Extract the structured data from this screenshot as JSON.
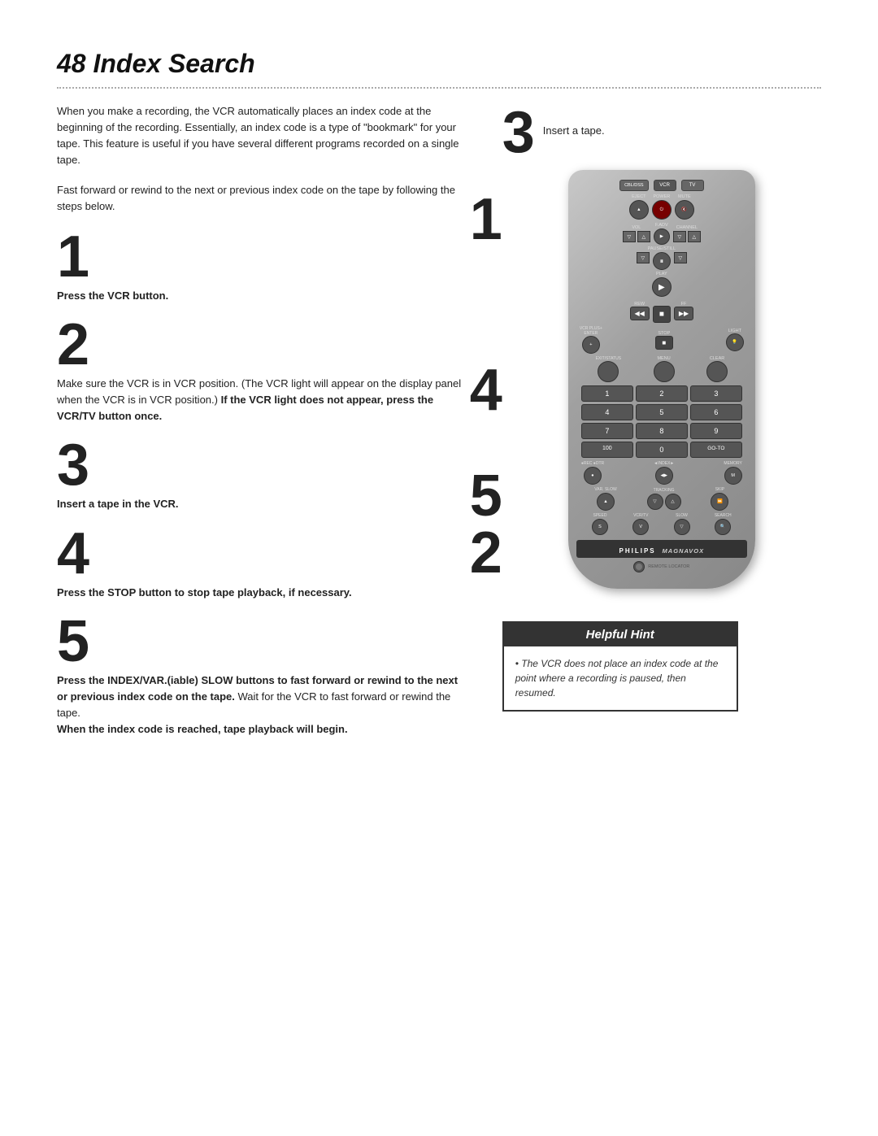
{
  "page": {
    "title": "48  Index Search",
    "dotted_rule": true
  },
  "intro": {
    "para1": "When you make a recording, the VCR automatically places an index code at the beginning of the recording. Essentially, an index code is a type of \"bookmark\" for your tape. This feature is useful if you have several different programs recorded on a single tape.",
    "para2": "Fast forward or rewind to the next or previous index code on the tape by following the steps below."
  },
  "steps": [
    {
      "number": "1",
      "text_normal": "",
      "text_bold": "Press the VCR button."
    },
    {
      "number": "2",
      "text_normal": "Make sure the VCR is in VCR position. (The VCR light will appear on the display panel when the VCR is in VCR position.) ",
      "text_bold": "If the VCR light does not appear, press the VCR/TV button once."
    },
    {
      "number": "3",
      "text_normal": "",
      "text_bold": "Insert a tape in the VCR."
    },
    {
      "number": "4",
      "text_normal": "",
      "text_bold": "Press the STOP button to stop tape playback, if necessary."
    },
    {
      "number": "5",
      "text_normal": "Press the INDEX/VAR.(iable) SLOW buttons to fast forward or rewind to the next or previous index code on the tape. ",
      "text_normal2": "Wait for the VCR to fast forward or rewind the tape.",
      "text_bold": "When the index code is reached, tape playback will begin."
    }
  ],
  "right_steps": [
    {
      "number": "3",
      "label": "Insert a tape."
    }
  ],
  "remote": {
    "buttons": {
      "cbl_dss": "CBL/DSS",
      "vcr": "VCR",
      "tv": "TV",
      "eject": "EJECT",
      "power": "POWER",
      "mute": "MUTE",
      "vol": "VOL",
      "fadv": "F.ADV",
      "channel": "CHANNEL",
      "pause_still": "PAUSE/STILL",
      "play": "PLAY",
      "rew": "REW",
      "ff": "FF",
      "stop": "STOP",
      "vcr_plus": "VCR PLUS+ ENTER",
      "light": "LIGHT",
      "exit_status": "EXIT/STATUS",
      "menu": "MENU",
      "clear": "CLEAR",
      "num1": "1",
      "num2": "2",
      "num3": "3",
      "num4": "4",
      "num5": "5",
      "num6": "6",
      "num7": "7",
      "num8": "8",
      "num9": "9",
      "num100": "100",
      "num0": "0",
      "goto": "GO-TO",
      "index": "◄INDEX►",
      "memory": "MEMORY",
      "var_slow": "VAR. SLOW",
      "tracking": "TRACKING",
      "skip": "SKIP",
      "speed": "SPEED",
      "vcr_tv": "VCR/TV",
      "slow": "SLOW",
      "search": "SEARCH"
    },
    "brand": "PHILIPS MAGNAVOX",
    "remote_locator": "REMOTE LOCATOR"
  },
  "helpful_hint": {
    "title": "Helpful Hint",
    "bullet": "The VCR does not place an index code at the point where a recording is paused, then resumed."
  },
  "right_side_numbers": [
    "1",
    "4",
    "5",
    "2"
  ]
}
